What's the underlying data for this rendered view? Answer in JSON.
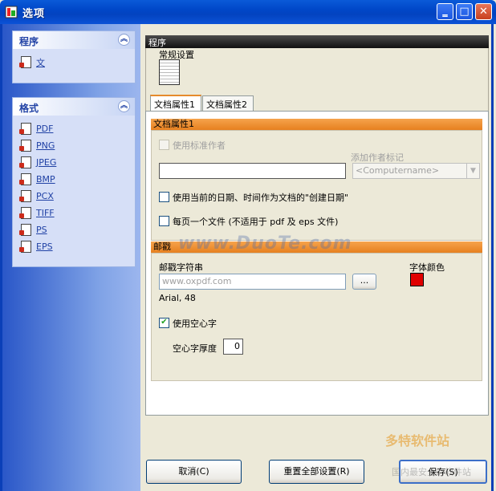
{
  "window": {
    "title": "选项",
    "min": "‗",
    "max": "□",
    "close": "✕"
  },
  "sidebar": {
    "groups": [
      {
        "title": "程序",
        "items": [
          {
            "label": "文"
          }
        ]
      },
      {
        "title": "格式",
        "items": [
          {
            "label": "PDF"
          },
          {
            "label": "PNG"
          },
          {
            "label": "JPEG"
          },
          {
            "label": "BMP"
          },
          {
            "label": "PCX"
          },
          {
            "label": "TIFF"
          },
          {
            "label": "PS"
          },
          {
            "label": "EPS"
          }
        ]
      }
    ]
  },
  "program_section": {
    "title": "程序",
    "general_label": "常规设置"
  },
  "tabs": [
    {
      "label": "文档属性1",
      "active": true
    },
    {
      "label": "文档属性2",
      "active": false
    }
  ],
  "doc_props": {
    "header": "文档属性1",
    "use_standard_author": "使用标准作者",
    "add_author_tag": "添加作者标记",
    "computername_option": "<Computername>",
    "use_current_date": "使用当前的日期、时间作为文档的\"创建日期\"",
    "one_file_per_page": "每页一个文件 (不适用于 pdf 及 eps 文件)"
  },
  "stamp": {
    "header": "邮戳",
    "string_label": "邮戳字符串",
    "string_placeholder": "www.oxpdf.com",
    "browse_label": "...",
    "font_info": "Arial, 48",
    "font_color_label": "字体颜色",
    "font_color": "#e00000",
    "use_outline": "使用空心字",
    "outline_thickness_label": "空心字厚度",
    "outline_thickness_value": "0"
  },
  "buttons": {
    "cancel": "取消(C)",
    "reset": "重置全部设置(R)",
    "save": "保存(S)"
  },
  "watermarks": {
    "center": "www.DuoTe.com",
    "logo": "多特软件站",
    "small": "国内最安全的软件站"
  }
}
